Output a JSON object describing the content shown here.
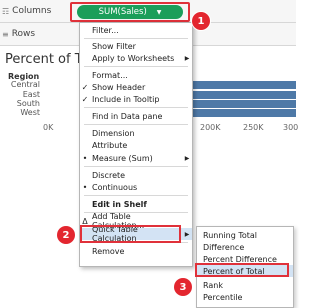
{
  "shelves": {
    "columns": {
      "label": "Columns",
      "icon": "columns-icon"
    },
    "rows": {
      "label": "Rows",
      "icon": "rows-icon"
    }
  },
  "pill": {
    "label": "SUM(Sales)",
    "color": "#1b9e5a"
  },
  "badges": [
    "1",
    "2",
    "3"
  ],
  "chart": {
    "title_visible": "Percent of Tot",
    "header": "Region"
  },
  "chart_data": {
    "type": "bar",
    "orientation": "horizontal",
    "categories": [
      "Central",
      "East",
      "South",
      "West"
    ],
    "values": [
      501240,
      678781,
      391722,
      725458
    ],
    "tick_labels": [
      "0K",
      "200K",
      "250K",
      "300"
    ],
    "xlim": [
      0,
      300000
    ],
    "bar_color": "#4e79a7"
  },
  "menu": {
    "items": [
      {
        "label": "Filter...",
        "mark": "",
        "arrow": false
      },
      {
        "label": "Show Filter",
        "mark": "",
        "arrow": false
      },
      {
        "label": "Apply to Worksheets",
        "mark": "",
        "arrow": true
      },
      {
        "label": "Format...",
        "mark": "",
        "arrow": false
      },
      {
        "label": "Show Header",
        "mark": "✓",
        "arrow": false
      },
      {
        "label": "Include in Tooltip",
        "mark": "✓",
        "arrow": false
      },
      {
        "label": "Find in Data pane",
        "mark": "",
        "arrow": false
      },
      {
        "label": "Dimension",
        "mark": "",
        "arrow": false
      },
      {
        "label": "Attribute",
        "mark": "",
        "arrow": false
      },
      {
        "label": "Measure (Sum)",
        "mark": "•",
        "arrow": true
      },
      {
        "label": "Discrete",
        "mark": "",
        "arrow": false
      },
      {
        "label": "Continuous",
        "mark": "•",
        "arrow": false
      },
      {
        "label": "Edit in Shelf",
        "mark": "",
        "arrow": false
      },
      {
        "label": "Add Table Calculation...",
        "mark": "Δ",
        "arrow": false
      },
      {
        "label": "Quick Table Calculation",
        "mark": "",
        "arrow": true
      },
      {
        "label": "Remove",
        "mark": "",
        "arrow": false
      }
    ]
  },
  "submenu": {
    "items": [
      "Running Total",
      "Difference",
      "Percent Difference",
      "Percent of Total",
      "Rank",
      "Percentile"
    ]
  },
  "colors": {
    "highlight": "#e0313a",
    "badge": "#e3262f",
    "selection": "#d3e3f4"
  }
}
